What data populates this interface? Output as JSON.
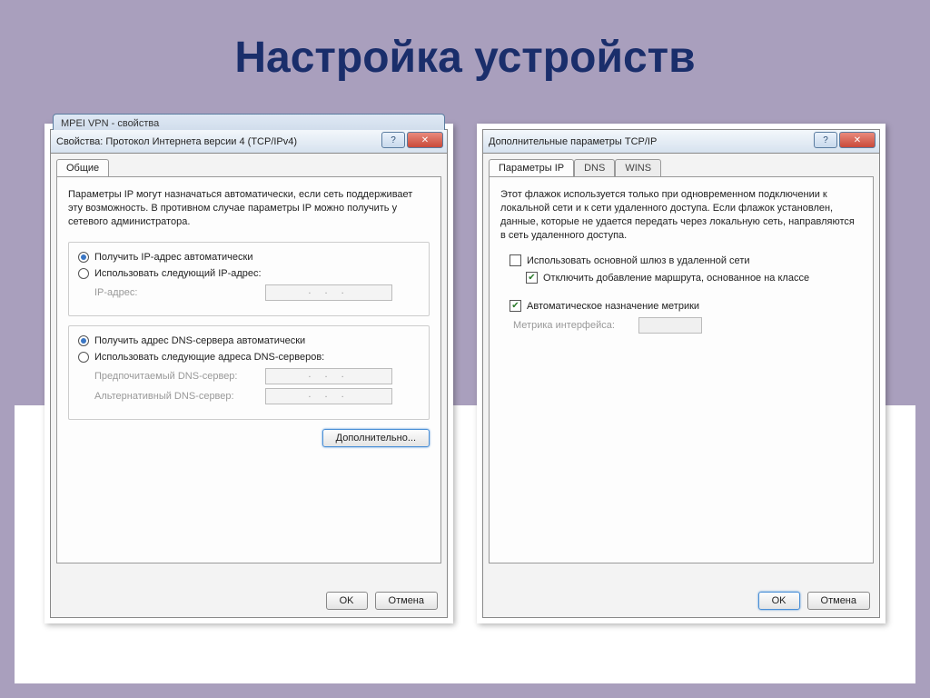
{
  "slide": {
    "title": "Настройка устройств"
  },
  "dialog1": {
    "bg_title": "MPEI VPN - свойства",
    "title": "Свойства: Протокол Интернета версии 4 (TCP/IPv4)",
    "tabs": {
      "general": "Общие"
    },
    "desc": "Параметры IP могут назначаться автоматически, если сеть поддерживает эту возможность. В противном случае параметры IP можно получить у сетевого администратора.",
    "radio_ip_auto": "Получить IP-адрес автоматически",
    "radio_ip_manual": "Использовать следующий IP-адрес:",
    "label_ip": "IP-адрес:",
    "radio_dns_auto": "Получить адрес DNS-сервера автоматически",
    "radio_dns_manual": "Использовать следующие адреса DNS-серверов:",
    "label_dns_pref": "Предпочитаемый DNS-сервер:",
    "label_dns_alt": "Альтернативный DNS-сервер:",
    "btn_advanced": "Дополнительно...",
    "btn_ok": "OK",
    "btn_cancel": "Отмена",
    "dots": ".   .   ."
  },
  "dialog2": {
    "title": "Дополнительные параметры TCP/IP",
    "tabs": {
      "ip": "Параметры IP",
      "dns": "DNS",
      "wins": "WINS"
    },
    "desc": "Этот флажок используется только при одновременном подключении к локальной сети и к сети удаленного доступа. Если флажок установлен, данные, которые не удается передать через локальную сеть, направляются в сеть удаленного доступа.",
    "check_gateway": "Использовать основной шлюз в удаленной сети",
    "check_route": "Отключить добавление маршрута, основанное на классе",
    "check_metric": "Автоматическое назначение метрики",
    "label_metric": "Метрика интерфейса:",
    "btn_ok": "OK",
    "btn_cancel": "Отмена"
  }
}
